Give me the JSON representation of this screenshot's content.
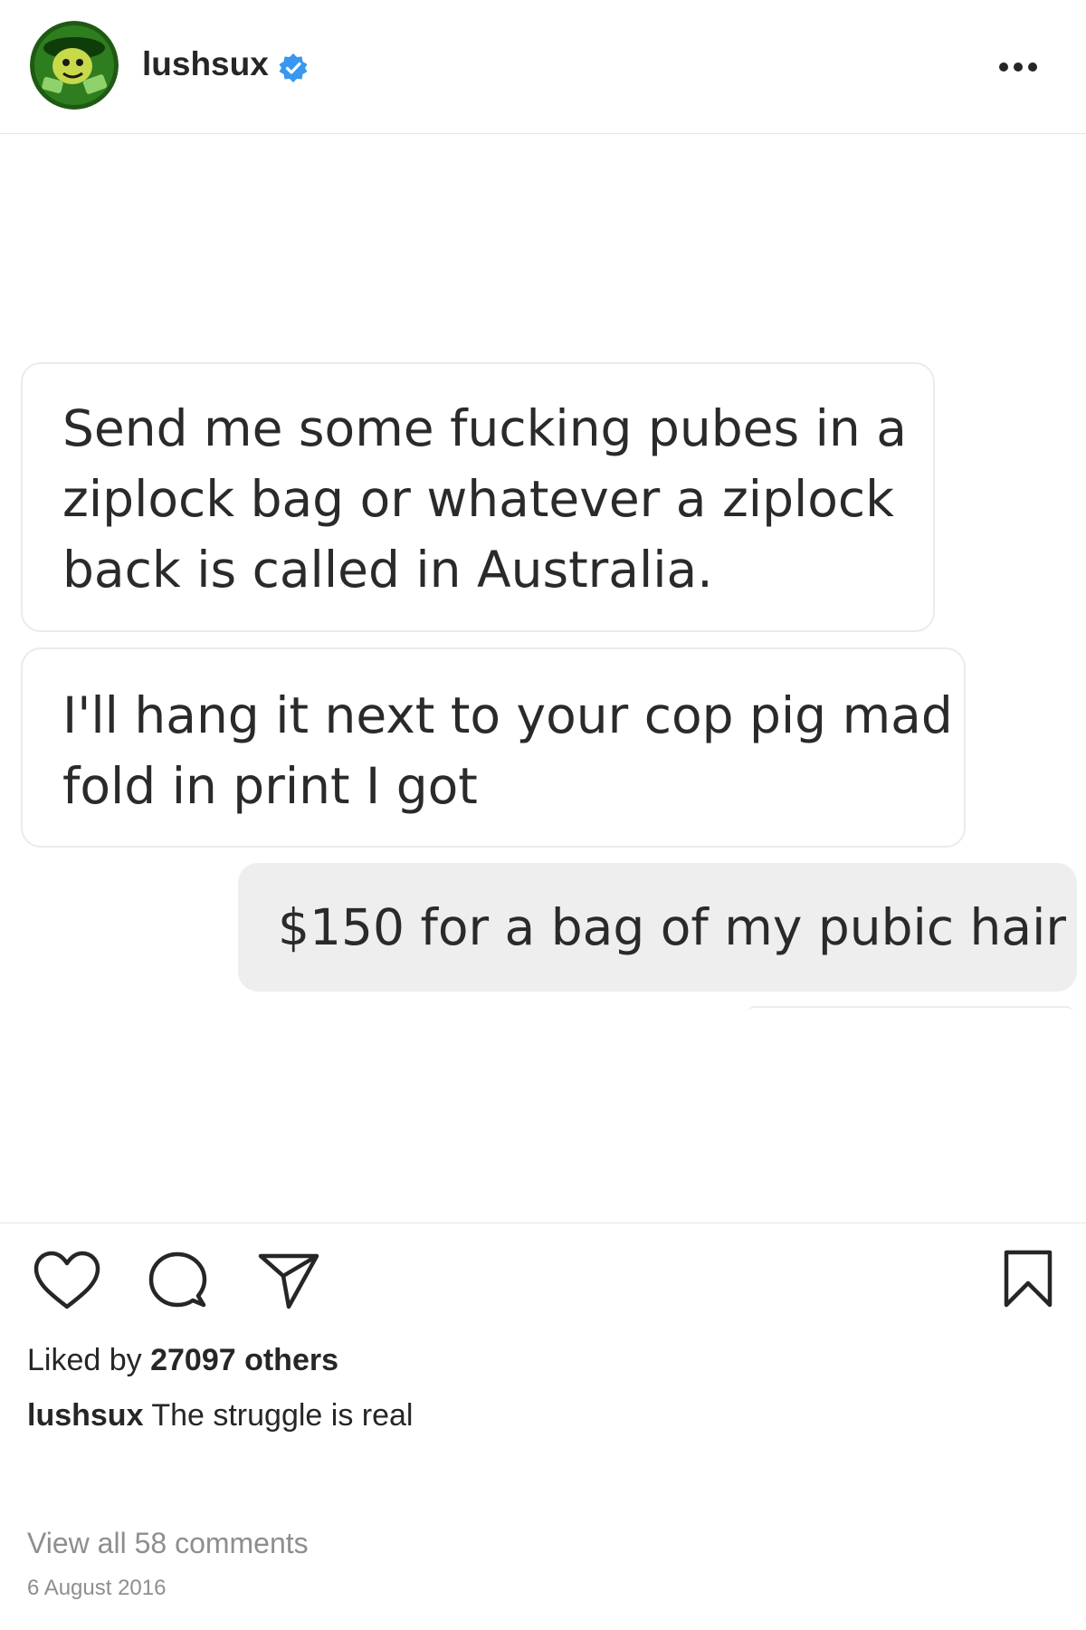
{
  "header": {
    "username": "lushsux",
    "verified_icon": "verified-badge-icon",
    "more_icon": "more-options-icon",
    "colors": {
      "verified": "#3897f0",
      "avatar_bg": "#2e7d1f"
    }
  },
  "post_image": {
    "messages": [
      {
        "direction": "incoming",
        "lines": [
          "Send me some fucking pubes in a",
          "ziplock bag or whatever a ziplock",
          "back is called in Australia."
        ]
      },
      {
        "direction": "incoming",
        "lines": [
          "I'll hang it next to your cop pig mad",
          "fold in print I got"
        ]
      },
      {
        "direction": "outgoing",
        "lines": [
          "$150 for a bag of my pubic hair"
        ]
      }
    ],
    "colors": {
      "incoming_bg": "#ffffff",
      "outgoing_bg": "#eeeeee",
      "bubble_border": "#ebebeb"
    }
  },
  "actions": {
    "like_icon": "heart-icon",
    "comment_icon": "comment-icon",
    "share_icon": "share-icon",
    "save_icon": "bookmark-icon"
  },
  "likes": {
    "prefix": "Liked by",
    "count_text": "27097 others"
  },
  "caption": {
    "username": "lushsux",
    "text": "The struggle is real"
  },
  "comments_link": "View all 58 comments",
  "date": "6 August 2016"
}
